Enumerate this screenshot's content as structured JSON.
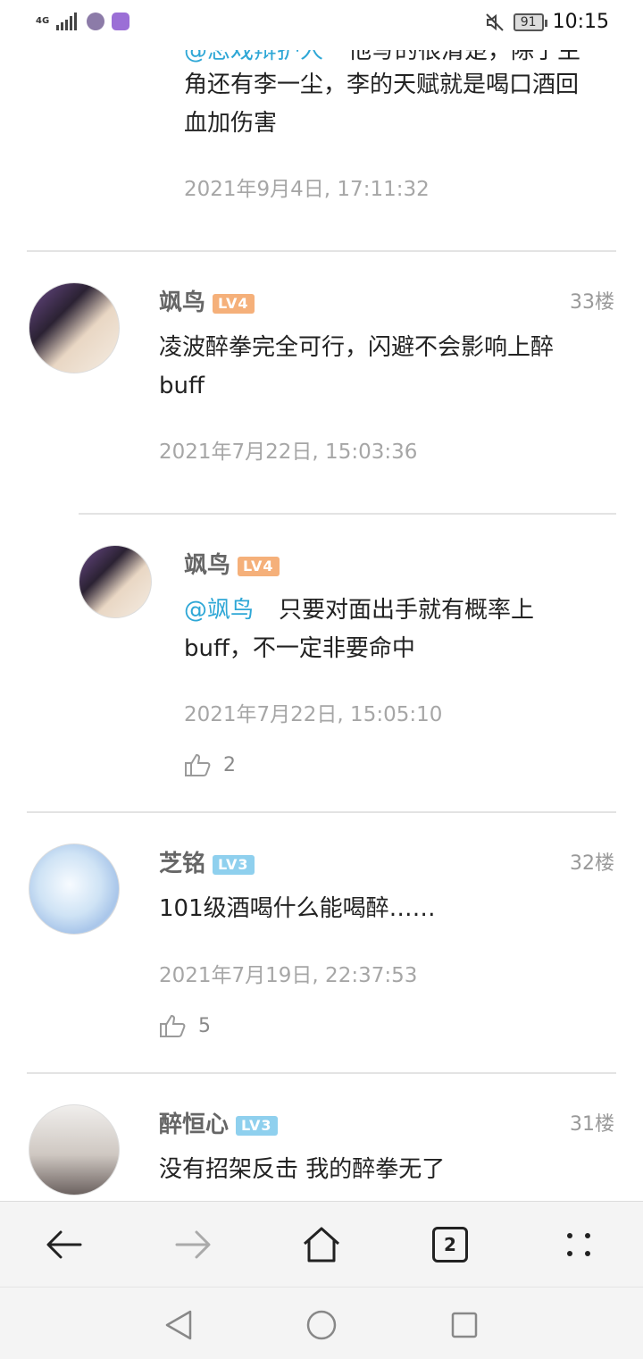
{
  "status_bar": {
    "network": "4G",
    "time": "10:15",
    "battery": "91"
  },
  "comments": [
    {
      "mention": "@恋戏辩护人",
      "text_line1": "他写的很清楚，除了主",
      "text_line2": "角还有李一尘，李的天赋就是喝口酒回",
      "text_line3": "血加伤害",
      "time": "2021年9月4日, 17:11:32"
    },
    {
      "user": "飒鸟",
      "level": "LV4",
      "floor": "33楼",
      "text_line1": "凌波醉拳完全可行，闪避不会影响上醉",
      "text_line2": "buff",
      "time": "2021年7月22日, 15:03:36"
    },
    {
      "user": "飒鸟",
      "level": "LV4",
      "mention": "@飒鸟",
      "text_line1": "只要对面出手就有概率上",
      "text_line2": "buff，不一定非要命中",
      "time": "2021年7月22日, 15:05:10",
      "likes": "2"
    },
    {
      "user": "芝铭",
      "level": "LV3",
      "floor": "32楼",
      "text_line1": "101级酒喝什么能喝醉……",
      "time": "2021年7月19日, 22:37:53",
      "likes": "5"
    },
    {
      "user": "醉恒心",
      "level": "LV3",
      "floor": "31楼",
      "text_line1": "没有招架反击 我的醉拳无了"
    }
  ],
  "browser_bar": {
    "tab_count": "2"
  },
  "colors": {
    "mention": "#2ea7d6",
    "lv4": "#f5b07a",
    "lv3": "#8fd0ee"
  }
}
